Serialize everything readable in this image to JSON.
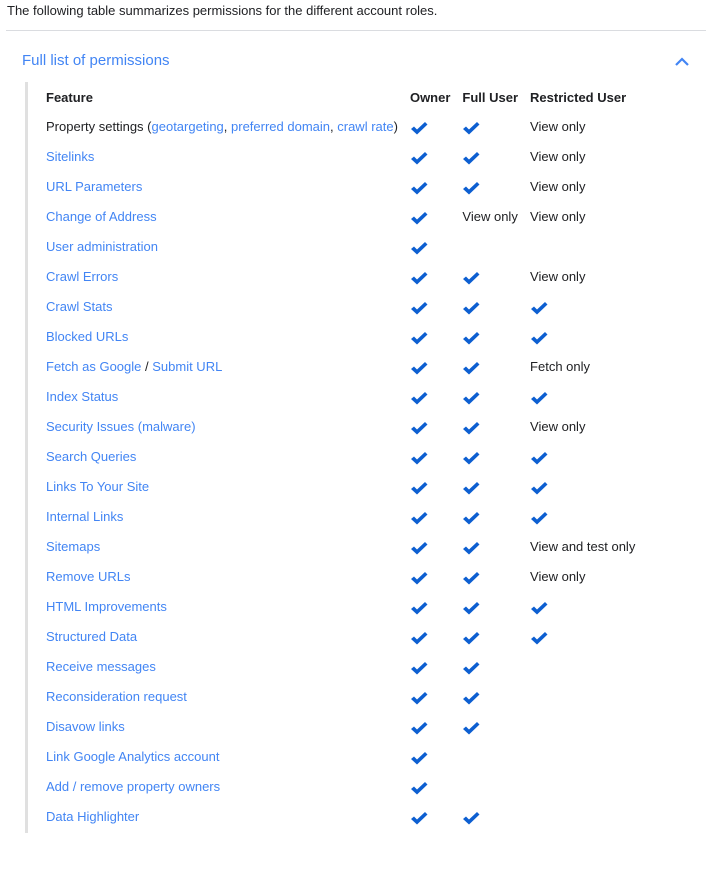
{
  "intro": "The following table summarizes permissions for the different account roles.",
  "expander": {
    "title": "Full list of permissions",
    "expanded": true,
    "icon": "chevron-up-icon"
  },
  "colors": {
    "link": "#4285f4",
    "check": "#0d5fd1",
    "text": "#202124"
  },
  "table": {
    "headers": [
      "Feature",
      "Owner",
      "Full User",
      "Restricted User"
    ],
    "rows": [
      {
        "feature": [
          {
            "text": "Property settings (",
            "link": false
          },
          {
            "text": "geotargeting",
            "link": true
          },
          {
            "text": ", ",
            "link": false
          },
          {
            "text": "preferred domain",
            "link": true
          },
          {
            "text": ", ",
            "link": false
          },
          {
            "text": "crawl rate",
            "link": true
          },
          {
            "text": ")",
            "link": false
          }
        ],
        "owner": "check",
        "full": "check",
        "restricted": "View only"
      },
      {
        "feature": [
          {
            "text": "Sitelinks",
            "link": true
          }
        ],
        "owner": "check",
        "full": "check",
        "restricted": "View only"
      },
      {
        "feature": [
          {
            "text": "URL Parameters",
            "link": true
          }
        ],
        "owner": "check",
        "full": "check",
        "restricted": "View only"
      },
      {
        "feature": [
          {
            "text": "Change of Address",
            "link": true
          }
        ],
        "owner": "check",
        "full": "View only",
        "restricted": "View only"
      },
      {
        "feature": [
          {
            "text": "User administration",
            "link": true
          }
        ],
        "owner": "check",
        "full": "",
        "restricted": ""
      },
      {
        "feature": [
          {
            "text": "Crawl Errors",
            "link": true
          }
        ],
        "owner": "check",
        "full": "check",
        "restricted": "View only"
      },
      {
        "feature": [
          {
            "text": "Crawl Stats",
            "link": true
          }
        ],
        "owner": "check",
        "full": "check",
        "restricted": "check"
      },
      {
        "feature": [
          {
            "text": "Blocked URLs",
            "link": true
          }
        ],
        "owner": "check",
        "full": "check",
        "restricted": "check"
      },
      {
        "feature": [
          {
            "text": "Fetch as Google",
            "link": true
          },
          {
            "text": " / ",
            "link": false
          },
          {
            "text": "Submit URL",
            "link": true
          }
        ],
        "owner": "check",
        "full": "check",
        "restricted": "Fetch only"
      },
      {
        "feature": [
          {
            "text": "Index Status",
            "link": true
          }
        ],
        "owner": "check",
        "full": "check",
        "restricted": "check"
      },
      {
        "feature": [
          {
            "text": "Security Issues (malware)",
            "link": true
          }
        ],
        "owner": "check",
        "full": "check",
        "restricted": "View only"
      },
      {
        "feature": [
          {
            "text": "Search Queries",
            "link": true
          }
        ],
        "owner": "check",
        "full": "check",
        "restricted": "check"
      },
      {
        "feature": [
          {
            "text": "Links To Your Site",
            "link": true
          }
        ],
        "owner": "check",
        "full": "check",
        "restricted": "check"
      },
      {
        "feature": [
          {
            "text": "Internal Links",
            "link": true
          }
        ],
        "owner": "check",
        "full": "check",
        "restricted": "check"
      },
      {
        "feature": [
          {
            "text": "Sitemaps",
            "link": true
          }
        ],
        "owner": "check",
        "full": "check",
        "restricted": "View and test only"
      },
      {
        "feature": [
          {
            "text": "Remove URLs",
            "link": true
          }
        ],
        "owner": "check",
        "full": "check",
        "restricted": "View only"
      },
      {
        "feature": [
          {
            "text": "HTML Improvements",
            "link": true
          }
        ],
        "owner": "check",
        "full": "check",
        "restricted": "check"
      },
      {
        "feature": [
          {
            "text": "Structured Data",
            "link": true
          }
        ],
        "owner": "check",
        "full": "check",
        "restricted": "check"
      },
      {
        "feature": [
          {
            "text": "Receive messages",
            "link": true
          }
        ],
        "owner": "check",
        "full": "check",
        "restricted": ""
      },
      {
        "feature": [
          {
            "text": "Reconsideration request",
            "link": true
          }
        ],
        "owner": "check",
        "full": "check",
        "restricted": ""
      },
      {
        "feature": [
          {
            "text": "Disavow links",
            "link": true
          }
        ],
        "owner": "check",
        "full": "check",
        "restricted": ""
      },
      {
        "feature": [
          {
            "text": "Link Google Analytics account",
            "link": true
          }
        ],
        "owner": "check",
        "full": "",
        "restricted": ""
      },
      {
        "feature": [
          {
            "text": "Add / remove property owners",
            "link": true
          }
        ],
        "owner": "check",
        "full": "",
        "restricted": ""
      },
      {
        "feature": [
          {
            "text": "Data Highlighter",
            "link": true
          }
        ],
        "owner": "check",
        "full": "check",
        "restricted": ""
      }
    ]
  }
}
